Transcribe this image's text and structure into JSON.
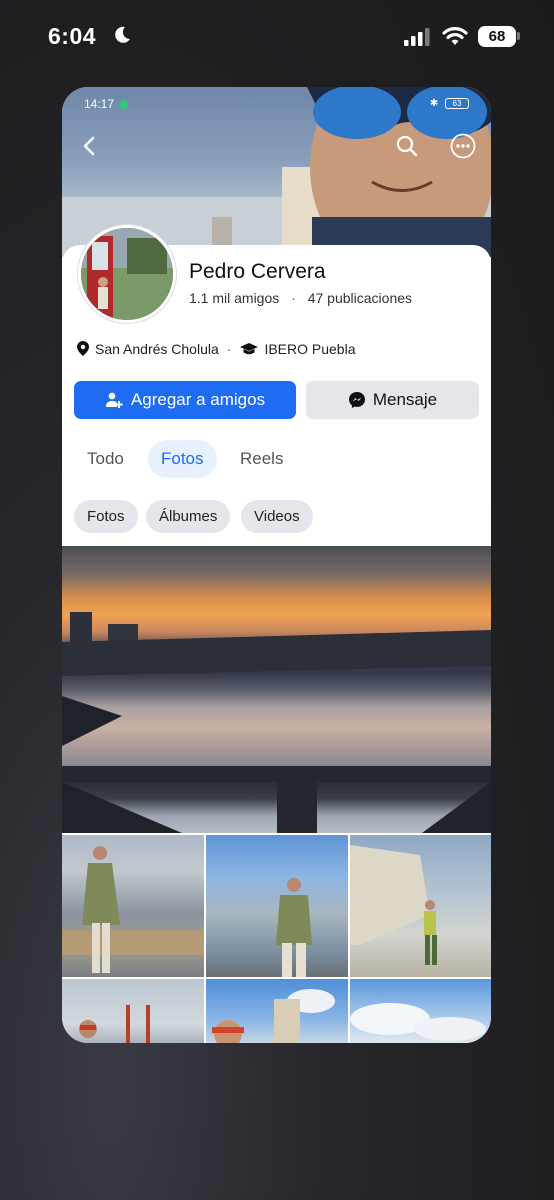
{
  "outer_status": {
    "time": "6:04",
    "battery": "68"
  },
  "inner_status": {
    "time": "14:17",
    "battery": "63"
  },
  "profile": {
    "name": "Pedro Cervera",
    "friends": "1.1 mil amigos",
    "separator": "·",
    "posts": "47 publicaciones",
    "location": "San Andrés Cholula",
    "education": "IBERO Puebla"
  },
  "actions": {
    "add_friend": "Agregar a amigos",
    "message": "Mensaje"
  },
  "tabs": [
    {
      "label": "Todo"
    },
    {
      "label": "Fotos"
    },
    {
      "label": "Reels"
    }
  ],
  "filters": [
    {
      "label": "Fotos"
    },
    {
      "label": "Álbumes"
    },
    {
      "label": "Videos"
    }
  ],
  "colors": {
    "primary": "#1e6cf2",
    "tab_active_bg": "#e7f0fd",
    "chip_bg": "#e4e6eb"
  }
}
